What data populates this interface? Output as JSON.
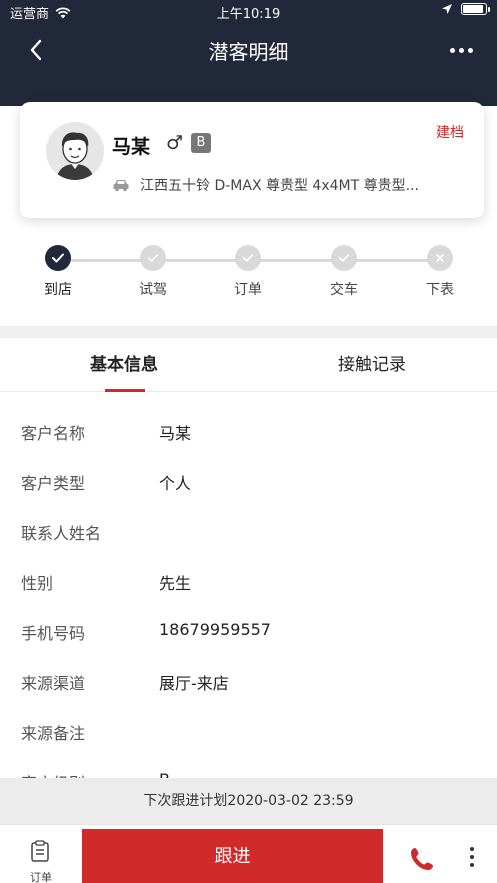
{
  "status_bar": {
    "carrier": "运营商",
    "time": "上午10:19",
    "icons": [
      "wifi-icon",
      "location-arrow-icon",
      "battery-icon"
    ],
    "battery_level": 0.9
  },
  "nav": {
    "title": "潜客明细",
    "back_icon": "chevron-left-icon",
    "more_icon": "more-horizontal-icon"
  },
  "customer_card": {
    "name": "马某",
    "gender_symbol": "♂",
    "level": "B",
    "action_label": "建档",
    "car_model": "江西五十铃 D-MAX 尊贵型 4x4MT 尊贵型...",
    "avatar_icon": "avatar-icon",
    "car_icon": "car-icon"
  },
  "progress_steps": [
    {
      "label": "到店",
      "status": "done"
    },
    {
      "label": "试驾",
      "status": "pending"
    },
    {
      "label": "订单",
      "status": "pending"
    },
    {
      "label": "交车",
      "status": "pending"
    },
    {
      "label": "下表",
      "status": "cancel"
    }
  ],
  "tabs": [
    {
      "label": "基本信息",
      "active": true
    },
    {
      "label": "接触记录",
      "active": false
    }
  ],
  "fields": [
    {
      "label": "客户名称",
      "value": "马某"
    },
    {
      "label": "客户类型",
      "value": "个人"
    },
    {
      "label": "联系人姓名",
      "value": ""
    },
    {
      "label": "性别",
      "value": "先生"
    },
    {
      "label": "手机号码",
      "value": "18679959557"
    },
    {
      "label": "来源渠道",
      "value": "展厅-来店"
    },
    {
      "label": "来源备注",
      "value": ""
    },
    {
      "label": "客户级别",
      "value": "B"
    }
  ],
  "plan_bar": {
    "text": "下次跟进计划2020-03-02 23:59"
  },
  "bottom_bar": {
    "order_label": "订单",
    "follow_label": "跟进",
    "order_icon": "clipboard-icon",
    "phone_icon": "phone-icon",
    "more_icon": "more-vertical-icon"
  },
  "colors": {
    "header_bg": "#20283a",
    "accent_red": "#d12a2a",
    "step_done": "#20283a",
    "step_pending": "#d9d9d9"
  }
}
